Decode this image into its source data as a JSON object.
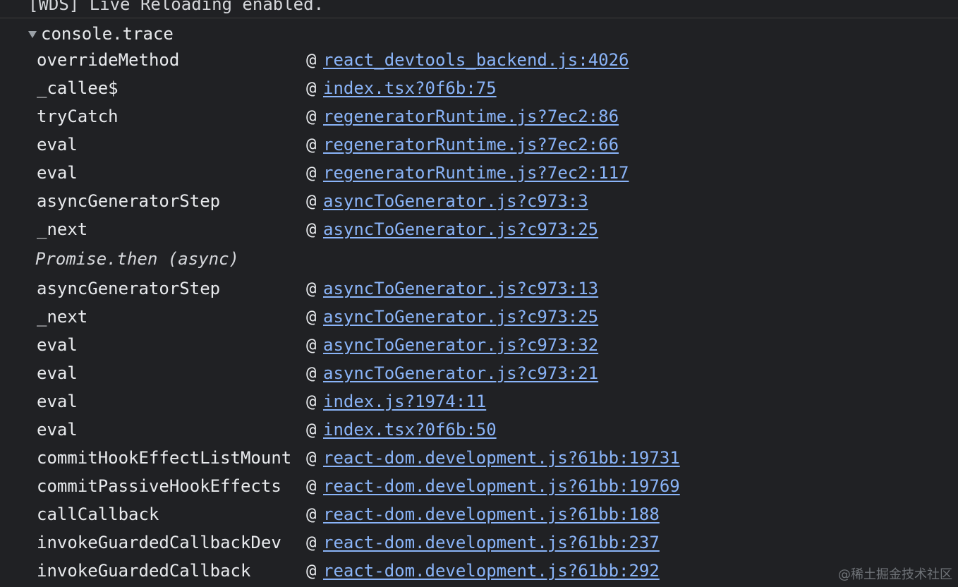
{
  "top_message": "[WDS] Live Reloading enabled.",
  "trace": {
    "label": "console.trace",
    "frames": [
      {
        "fn": "overrideMethod",
        "src": "react_devtools_backend.js:4026"
      },
      {
        "fn": "_callee$",
        "src": "index.tsx?0f6b:75"
      },
      {
        "fn": "tryCatch",
        "src": "regeneratorRuntime.js?7ec2:86"
      },
      {
        "fn": "eval",
        "src": "regeneratorRuntime.js?7ec2:66"
      },
      {
        "fn": "eval",
        "src": "regeneratorRuntime.js?7ec2:117"
      },
      {
        "fn": "asyncGeneratorStep",
        "src": "asyncToGenerator.js?c973:3"
      },
      {
        "fn": "_next",
        "src": "asyncToGenerator.js?c973:25"
      },
      {
        "async": "Promise.then (async)"
      },
      {
        "fn": "asyncGeneratorStep",
        "src": "asyncToGenerator.js?c973:13"
      },
      {
        "fn": "_next",
        "src": "asyncToGenerator.js?c973:25"
      },
      {
        "fn": "eval",
        "src": "asyncToGenerator.js?c973:32"
      },
      {
        "fn": "eval",
        "src": "asyncToGenerator.js?c973:21"
      },
      {
        "fn": "eval",
        "src": "index.js?1974:11"
      },
      {
        "fn": "eval",
        "src": "index.tsx?0f6b:50"
      },
      {
        "fn": "commitHookEffectListMount",
        "src": "react-dom.development.js?61bb:19731"
      },
      {
        "fn": "commitPassiveHookEffects",
        "src": "react-dom.development.js?61bb:19769"
      },
      {
        "fn": "callCallback",
        "src": "react-dom.development.js?61bb:188"
      },
      {
        "fn": "invokeGuardedCallbackDev",
        "src": "react-dom.development.js?61bb:237"
      },
      {
        "fn": "invokeGuardedCallback",
        "src": "react-dom.development.js?61bb:292"
      }
    ]
  },
  "at_symbol": "@",
  "watermark": "@稀土掘金技术社区",
  "colors": {
    "background": "#202124",
    "text": "#e8eaed",
    "link": "#8ab4f8"
  }
}
